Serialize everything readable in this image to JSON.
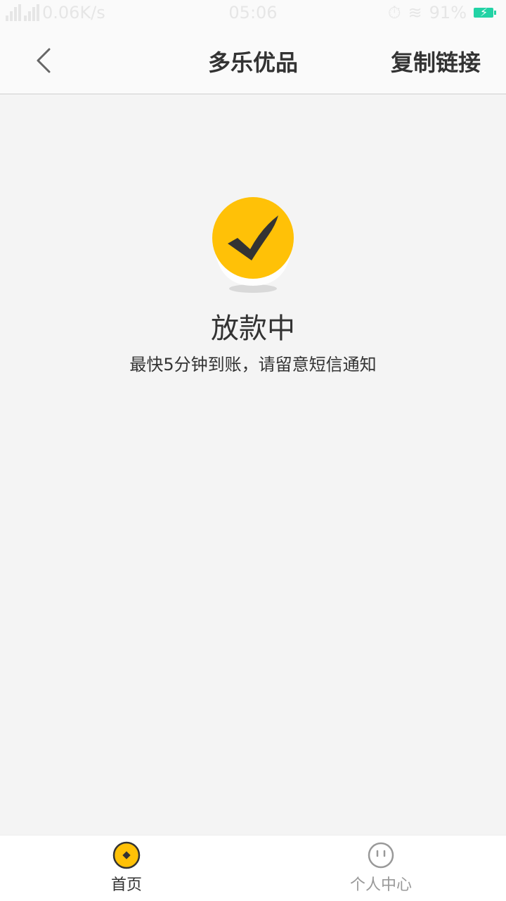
{
  "status_bar": {
    "network_speed": "0.06K/s",
    "time": "05:06",
    "battery_percent": "91%"
  },
  "nav": {
    "title": "多乐优品",
    "copy_link_label": "复制链接"
  },
  "main": {
    "status_title": "放款中",
    "status_subtitle": "最快5分钟到账，请留意短信通知"
  },
  "tabs": [
    {
      "label": "首页",
      "icon": "home-coin-icon",
      "active": true
    },
    {
      "label": "个人中心",
      "icon": "profile-face-icon",
      "active": false
    }
  ],
  "colors": {
    "accent": "#FFC107",
    "check_dark": "#333333",
    "battery": "#22D3A5"
  }
}
